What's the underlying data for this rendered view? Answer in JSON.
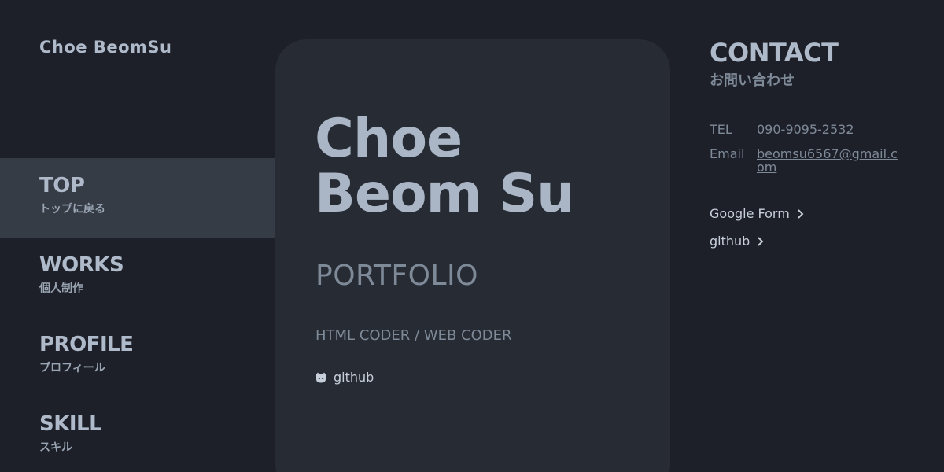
{
  "brand": "Choe BeomSu",
  "nav": [
    {
      "title": "TOP",
      "sub": "トップに戻る",
      "active": true
    },
    {
      "title": "WORKS",
      "sub": "個人制作",
      "active": false
    },
    {
      "title": "PROFILE",
      "sub": "プロフィール",
      "active": false
    },
    {
      "title": "SKILL",
      "sub": "スキル",
      "active": false
    }
  ],
  "hero": {
    "name_line1": "Choe",
    "name_line2": "Beom Su",
    "portfolio": "PORTFOLIO",
    "role": "HTML CODER / WEB CODER",
    "github_label": "github",
    "github_icon": "github-icon"
  },
  "contact": {
    "title": "CONTACT",
    "subtitle": "お問い合わせ",
    "tel_label": "TEL",
    "tel_value": "090-9095-2532",
    "email_label": "Email",
    "email_value": "beomsu6567@gmail.com",
    "google_form_label": "Google Form",
    "github_label": "github"
  },
  "colors": {
    "background": "#1d2028",
    "card": "#272b34",
    "active_nav": "#363c46",
    "text": "#aab6c6",
    "muted": "#7f8a99"
  }
}
